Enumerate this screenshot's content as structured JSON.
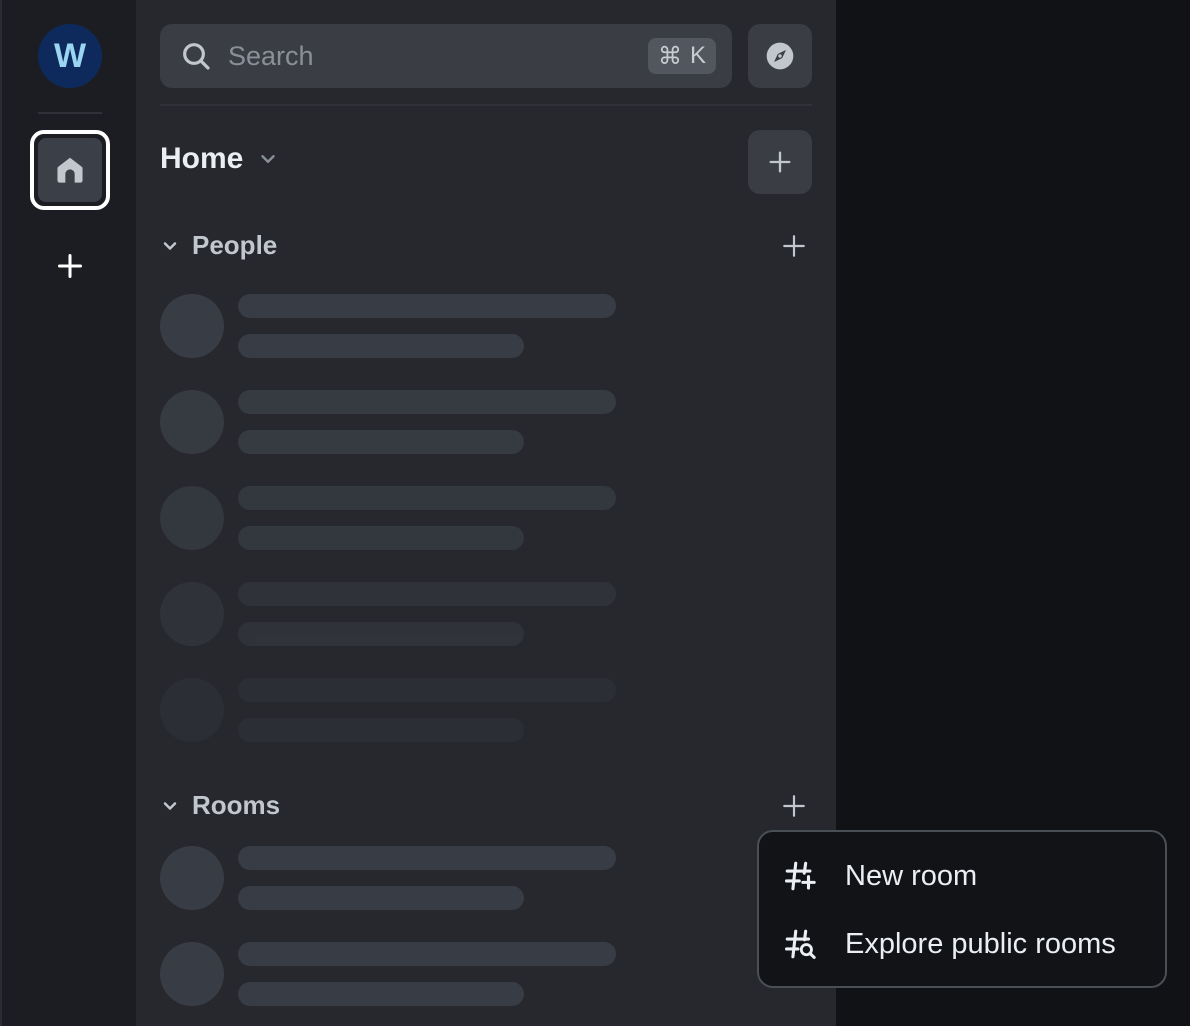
{
  "spacebar": {
    "avatar_letter": "W",
    "home_icon": "home-icon",
    "add_icon": "plus-icon"
  },
  "search": {
    "placeholder": "Search",
    "shortcut_symbol": "⌘",
    "shortcut_key": "K"
  },
  "header": {
    "title": "Home"
  },
  "sections": {
    "people": {
      "title": "People"
    },
    "rooms": {
      "title": "Rooms"
    }
  },
  "menu": {
    "items": [
      {
        "label": "New room",
        "icon": "room-add-icon"
      },
      {
        "label": "Explore public rooms",
        "icon": "explore-rooms-icon"
      }
    ]
  },
  "colors": {
    "spacebar_bg": "#1b1d22",
    "roomlist_bg": "#26282d",
    "main_bg": "#101216",
    "avatar_bg": "#0e2a5c",
    "avatar_text": "#9ad6f2",
    "skeleton": "#383c44"
  }
}
